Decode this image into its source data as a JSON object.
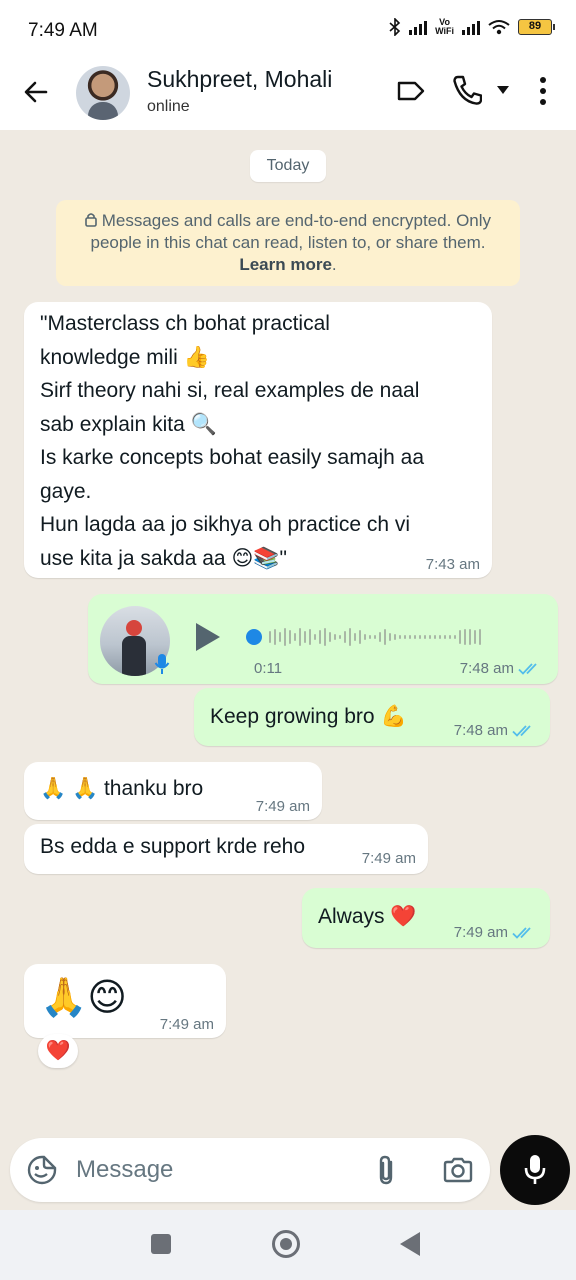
{
  "status_bar": {
    "time": "7:49 AM",
    "volte_label": "Vo\nWiFi",
    "battery": "89"
  },
  "header": {
    "contact_name": "Sukhpreet, Mohali",
    "contact_status": "online",
    "icons": [
      "back-arrow-icon",
      "label-icon",
      "phone-icon",
      "dropdown-icon",
      "more-vert-icon"
    ]
  },
  "chat": {
    "date_chip": "Today",
    "encryption_notice": {
      "text": "Messages and calls are end-to-end encrypted. Only people in this chat can read, listen to, or share them.",
      "link": "Learn more"
    },
    "messages": [
      {
        "direction": "incoming",
        "text": "\"Masterclass ch bohat practical\nknowledge mili 👍\nSirf theory nahi si, real examples de naal\nsab explain kita 🔍\nIs karke concepts bohat easily samajh aa\ngaye.\nHun lagda aa jo sikhya oh practice ch vi\nuse kita ja sakda aa 😊📚\"",
        "time": "7:43 am"
      },
      {
        "direction": "outgoing",
        "type": "voice",
        "duration": "0:11",
        "time": "7:48 am",
        "read": true
      },
      {
        "direction": "outgoing",
        "text": "Keep growing bro 💪",
        "time": "7:48 am",
        "read": true
      },
      {
        "direction": "incoming",
        "text": "🙏 🙏 thanku bro",
        "time": "7:49 am"
      },
      {
        "direction": "incoming",
        "text": "Bs edda e support krde reho",
        "time": "7:49 am"
      },
      {
        "direction": "outgoing",
        "text": "Always ❤️",
        "time": "7:49 am",
        "read": true
      },
      {
        "direction": "incoming",
        "text": "🙏😊",
        "time": "7:49 am",
        "reaction": "❤️"
      }
    ]
  },
  "composer": {
    "placeholder": "Message",
    "icons": [
      "sticker-icon",
      "attach-icon",
      "camera-icon",
      "mic-icon"
    ]
  },
  "colors": {
    "chat_background": "#efeae2",
    "incoming_bubble": "#ffffff",
    "outgoing_bubble": "#d9fdd3",
    "read_ticks": "#53bdeb",
    "encryption_bg": "#fdf1cf"
  }
}
